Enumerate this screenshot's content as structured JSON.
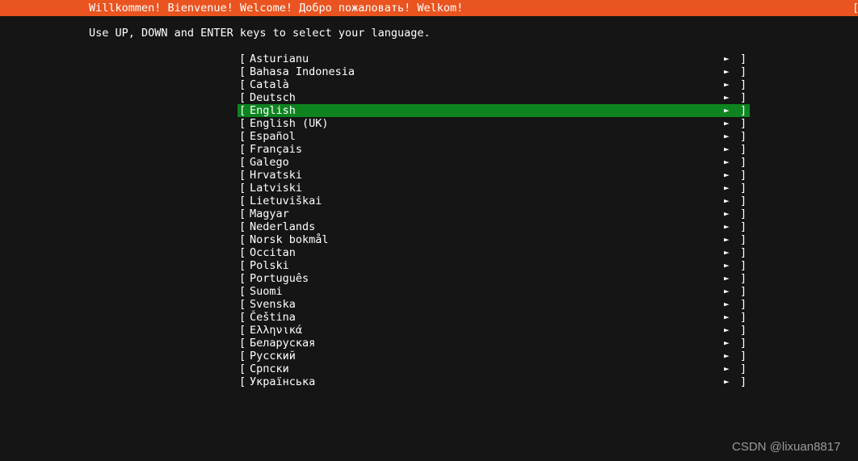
{
  "colors": {
    "background": "#151515",
    "header_background": "#e95420",
    "header_text": "#ffffff",
    "body_text": "#ffffff",
    "selection_background": "#0e8420",
    "watermark_text": "#9a9a9a"
  },
  "header": {
    "title": "Willkommen! Bienvenue! Welcome! Добро пожаловать! Welkom!",
    "edge_bracket": "["
  },
  "instruction": "Use UP, DOWN and ENTER keys to select your language.",
  "list": {
    "open_bracket": "[",
    "close_bracket": "]",
    "arrow": "►",
    "selected_index": 4,
    "items": [
      {
        "label": "Asturianu"
      },
      {
        "label": "Bahasa Indonesia"
      },
      {
        "label": "Català"
      },
      {
        "label": "Deutsch"
      },
      {
        "label": "English"
      },
      {
        "label": "English (UK)"
      },
      {
        "label": "Español"
      },
      {
        "label": "Français"
      },
      {
        "label": "Galego"
      },
      {
        "label": "Hrvatski"
      },
      {
        "label": "Latviski"
      },
      {
        "label": "Lietuviškai"
      },
      {
        "label": "Magyar"
      },
      {
        "label": "Nederlands"
      },
      {
        "label": "Norsk bokmål"
      },
      {
        "label": "Occitan"
      },
      {
        "label": "Polski"
      },
      {
        "label": "Português"
      },
      {
        "label": "Suomi"
      },
      {
        "label": "Svenska"
      },
      {
        "label": "Čeština"
      },
      {
        "label": "Ελληνικά"
      },
      {
        "label": "Беларуская"
      },
      {
        "label": "Русский"
      },
      {
        "label": "Српски"
      },
      {
        "label": "Українська"
      }
    ]
  },
  "watermark": "CSDN @lixuan8817"
}
